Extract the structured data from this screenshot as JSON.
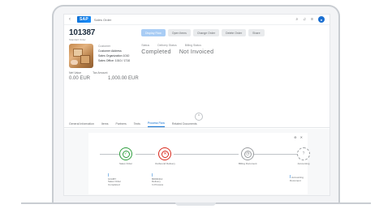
{
  "shell": {
    "logo": "SAP",
    "title": "Sales Order"
  },
  "header": {
    "id": "101387",
    "subtitle": "Standard Order",
    "actions": [
      {
        "label": "Display Flow",
        "primary": true
      },
      {
        "label": "Open Items"
      },
      {
        "label": "Change Order"
      },
      {
        "label": "Delete Order"
      },
      {
        "label": "Share"
      }
    ]
  },
  "summary": {
    "customer_label": "Customer",
    "address_label": "Customer Address",
    "address_value": "Sales Organization 1010",
    "line3": "Sales Office: 1010 / 1710",
    "kpi_labels": [
      "Status",
      "Delivery Status",
      "Billing Status"
    ],
    "kpi_values": [
      "Completed",
      "Not Invoiced"
    ],
    "amount_labels": [
      "Net Value",
      "Tax Amount"
    ],
    "amount_values": [
      "0.00 EUR",
      "1,000.00 EUR"
    ]
  },
  "tabs": [
    "General Information",
    "Items",
    "Partners",
    "Texts",
    "Process Flow",
    "Related Documents"
  ],
  "active_tab": 4,
  "flow": {
    "nodes": [
      {
        "label": "Sales Order",
        "status": "green",
        "glyph": "✓"
      },
      {
        "label": "Outbound Delivery",
        "status": "red",
        "glyph": "✕"
      },
      {
        "label": "Billing Document",
        "status": "grey",
        "glyph": "◷"
      },
      {
        "label": "Accounting",
        "status": "dash",
        "glyph": "?"
      }
    ],
    "docs": [
      {
        "title": "101387",
        "line1": "Sales Order",
        "line2": "Completed"
      },
      {
        "title": "80000412",
        "line1": "Delivery",
        "line2": "In Process"
      },
      {
        "title": "",
        "line1": "Accounting Document",
        "line2": ""
      }
    ]
  }
}
